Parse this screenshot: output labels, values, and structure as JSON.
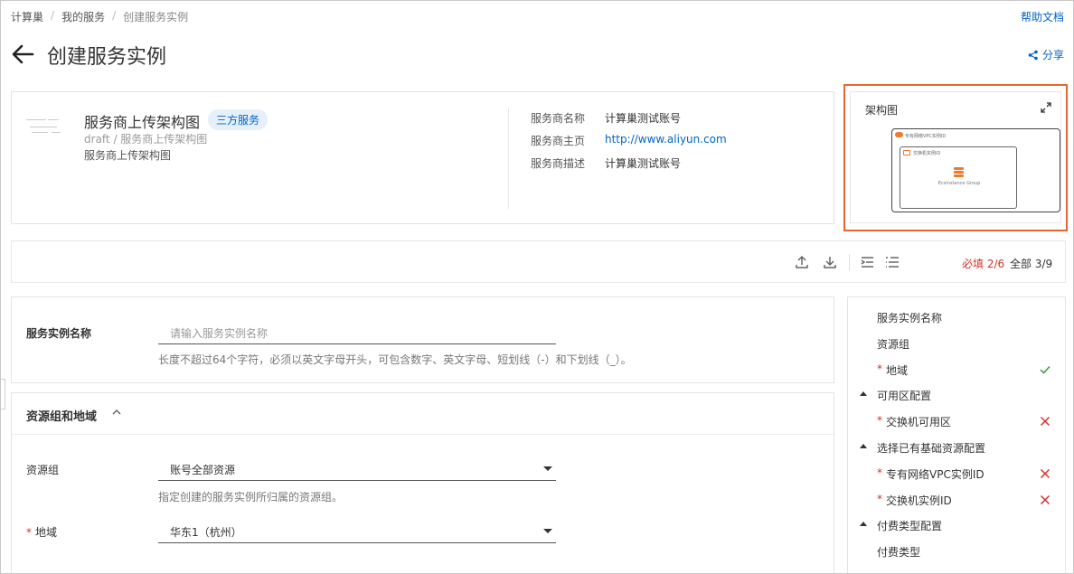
{
  "breadcrumb": [
    "计算巢",
    "我的服务",
    "创建服务实例"
  ],
  "help_link": "帮助文档",
  "page_title": "创建服务实例",
  "share_label": "分享",
  "service": {
    "name": "服务商上传架构图",
    "badge": "三方服务",
    "subtitle": "draft / 服务商上传架构图",
    "description": "服务商上传架构图"
  },
  "provider": [
    {
      "key": "服务商名称",
      "value": "计算巢测试账号"
    },
    {
      "key": "服务商主页",
      "value": "http://www.aliyun.com"
    },
    {
      "key": "服务商描述",
      "value": "计算巢测试账号"
    }
  ],
  "architecture": {
    "title": "架构图",
    "vpc_label": "专有网络VPC实例ID",
    "vswitch_label": "交换机实例ID",
    "ecs_label": "EcsInstance Group"
  },
  "toolbar": {
    "required_label": "必填 2/6",
    "all_label": "全部 3/9"
  },
  "form": {
    "instance_name": {
      "label": "服务实例名称",
      "placeholder": "请输入服务实例名称",
      "hint": "长度不超过64个字符，必须以英文字母开头，可包含数字、英文字母、短划线（-）和下划线（_）。"
    },
    "section_title": "资源组和地域",
    "resource_group": {
      "label": "资源组",
      "value": "账号全部资源",
      "hint": "指定创建的服务实例所归属的资源组。"
    },
    "region": {
      "label": "地域",
      "value": "华东1（杭州）"
    }
  },
  "nav": [
    {
      "label": "服务实例名称",
      "type": "item",
      "required": false,
      "status": ""
    },
    {
      "label": "资源组",
      "type": "item",
      "required": false,
      "status": ""
    },
    {
      "label": "地域",
      "type": "item",
      "required": true,
      "status": "ok"
    },
    {
      "label": "可用区配置",
      "type": "group",
      "required": false,
      "status": ""
    },
    {
      "label": "交换机可用区",
      "type": "item",
      "required": true,
      "status": "error"
    },
    {
      "label": "选择已有基础资源配置",
      "type": "group",
      "required": false,
      "status": ""
    },
    {
      "label": "专有网络VPC实例ID",
      "type": "item",
      "required": true,
      "status": "error"
    },
    {
      "label": "交换机实例ID",
      "type": "item",
      "required": true,
      "status": "error"
    },
    {
      "label": "付费类型配置",
      "type": "group",
      "required": false,
      "status": ""
    },
    {
      "label": "付费类型",
      "type": "item",
      "required": false,
      "status": ""
    }
  ],
  "colors": {
    "accent": "#0064c8",
    "required": "#d93026",
    "ok": "#3a9b3a",
    "highlight_border": "#e4672f",
    "badge_bg": "#e5f0fb"
  }
}
